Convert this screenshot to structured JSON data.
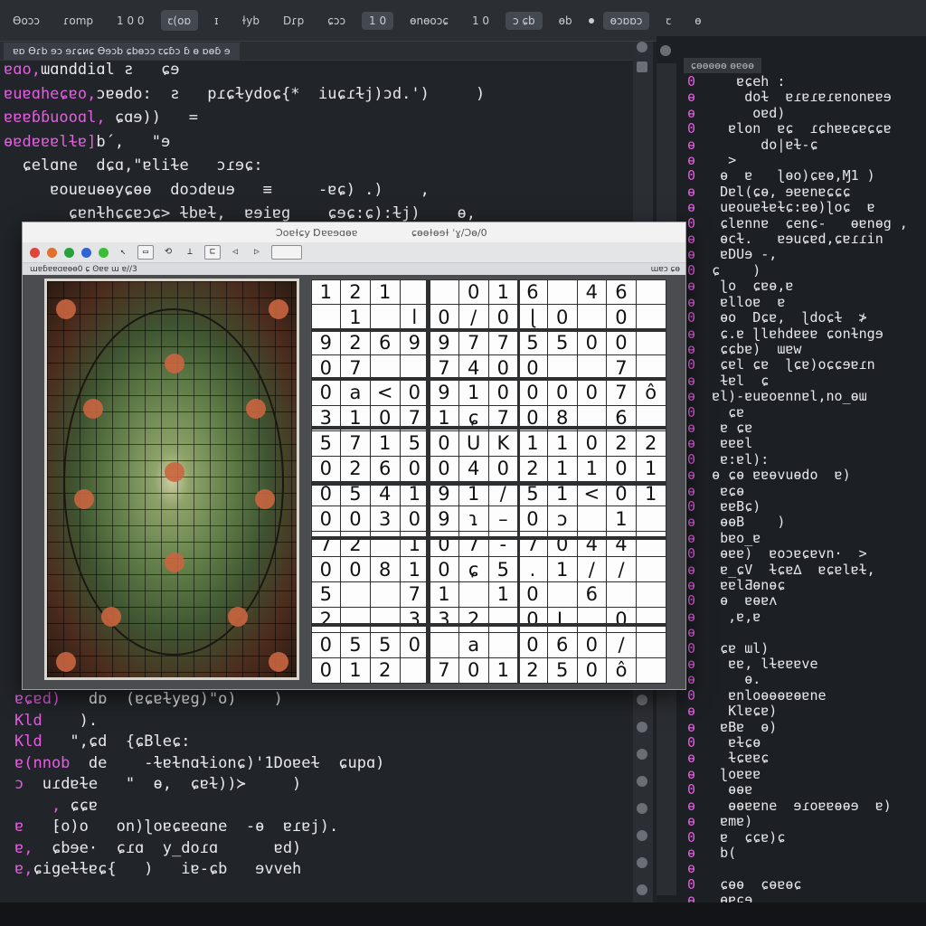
{
  "toolbar": {
    "items": [
      "Ɵoɔɔ",
      "ɾomp",
      "1 0 0",
      "ꞇ(oɒ",
      "ɪ",
      "ɫyb",
      "Dɾp",
      "ɕɔɔ",
      "1 0",
      "ɵnɵoɔɕ",
      "1 0",
      "ɔ ɕb",
      "ɵb",
      "",
      "ɵɔɒɒɔ",
      "ꞇ",
      "ɵ"
    ]
  },
  "left_editor": {
    "tab": "ɐɒ Ɵɾb ɘɔ ɘɾɕᴎɕ Ɵɘɔb ɕbɵɔɔ ꞇɕɓɔ ɓ ɵ ɒɵɓ ɘ",
    "lines": [
      [
        "ɐɑo,",
        "ɯɑnddiɑl",
        " ƨ   ɕɘ"
      ],
      [
        "ɐuɐɑheɕɐo,",
        "ɔɐɵdo:",
        "  ƨ   pɾɕɫydoɕ{*  iuɕɾɫj)ɔd.')     )"
      ],
      [
        "ɐɐɐɓɓuooɑl,",
        "",
        " ɕɑɘ))   ="
      ],
      [
        "ɵɐdɐɐɐlɫɐ]",
        "",
        "b´,   \"ɘ"
      ],
      [
        "",
        "  ɕelɑne",
        "  dɕɑ,\"ɐliɫe   ɔɾɘɕ:"
      ],
      [
        "",
        "     ɐouɐuɵɵyɕɵɵ",
        "  doɔdɐuɘ   ≡     -ɐɕ) .)    ,"
      ],
      [
        "",
        "       ɕɐnɫhɕɕɐɔɕ>",
        " ɫbɐɫ,  ɐɘiɐg    ɕɘɕ:ɕ):ɫj)    ɵ,"
      ]
    ],
    "lower_lines": [
      [
        "ɐɕɐd)",
        "   dɒ  (ɐɕɐɫyɐg)\"o)    )"
      ],
      [
        "Kld",
        "    )."
      ],
      [
        "Kld",
        "   \",ɕd  {ɕBleɕ:"
      ],
      [
        "ɐ(nnob",
        "  de    -ɫɐɫnɑɫionɕ)'1Doɐeɫ  ɕupɑ) "
      ],
      [
        "ɔ ",
        " uɾdɐɫe   \"  ɵ,  ɕɐɫ))≻     )"
      ],
      [
        "    ,",
        " ɕɕɐ"
      ],
      [
        "ɐ",
        "   ⁅o)o   on)ɭoɐɕɐeɑne  -ɵ  ɐɾɐj)."
      ],
      [
        "ɐ,",
        "  ɕbɘe·  ɕɾɑ  y_doɾɑ      ɐd)"
      ],
      [
        "",
        ""
      ],
      [
        "ɐ,",
        "ɕigeɫɫɐɕ{   )   iɐ-ɕb   ɘvveh"
      ]
    ]
  },
  "window": {
    "title_left": "Ɔoɐɫɕy Ɒɐɐɘɑɵɐ",
    "title_right": "ɕɵɵɫɵɘɫ   ˈɣ/Ɔɵ/0",
    "subbar_left": "ɯɐɓɐɐɑɐɵɵ0   ɕ   ʘɐɐ ɯ ɐ//3",
    "subbar_right": "ɯɐɔ ɕɵ",
    "grid_rows": [
      [
        "1",
        "2",
        "1",
        "",
        "",
        "0",
        "1",
        "6",
        "",
        "4",
        "6",
        ""
      ],
      [
        "",
        "1",
        "",
        "l",
        "0",
        "/",
        "0",
        "ɭ",
        "0",
        "",
        "0",
        ""
      ],
      [
        "9",
        "2",
        "6",
        "9",
        "9",
        "7",
        "7",
        "5",
        "5",
        "0",
        "0",
        ""
      ],
      [
        "0",
        "7",
        "",
        "",
        "7",
        "4",
        "0",
        "0",
        "",
        "",
        "7",
        ""
      ],
      [
        "0",
        "a",
        "<",
        "0",
        "9",
        "1",
        "0",
        "0",
        "0",
        "0",
        "7",
        "ô"
      ],
      [
        "3",
        "1",
        "0",
        "7",
        "1",
        "ɕ",
        "7",
        "0",
        "8",
        "",
        "6",
        ""
      ],
      [
        "5",
        "7",
        "1",
        "5",
        "0",
        "U",
        "K",
        "1",
        "1",
        "0",
        "2",
        "2"
      ],
      [
        "0",
        "2",
        "6",
        "0",
        "0",
        "4",
        "0",
        "2",
        "1",
        "1",
        "0",
        "1"
      ],
      [
        "0",
        "5",
        "4",
        "1",
        "9",
        "1",
        "/",
        "5",
        "1",
        "<",
        "0",
        "1"
      ],
      [
        "0",
        "0",
        "3",
        "0",
        "9",
        "ɿ",
        "–",
        "0",
        "ɔ",
        "",
        "1",
        ""
      ],
      [
        "7",
        "2",
        "",
        "1",
        "0",
        "7",
        "-",
        "7",
        "0",
        "4",
        "4",
        ""
      ],
      [
        "0",
        "0",
        "8",
        "1",
        "0",
        "ɕ",
        "5",
        ".",
        "1",
        "/",
        "/",
        ""
      ],
      [
        "5",
        "",
        "",
        "7",
        "1",
        "",
        "1",
        "0",
        "",
        "6",
        "",
        ""
      ],
      [
        "2",
        "",
        "",
        "3",
        "3",
        "2",
        "",
        "0",
        "L",
        "",
        "0",
        ""
      ],
      [
        "0",
        "5",
        "5",
        "0",
        "",
        "a",
        "",
        "0",
        "6",
        "0",
        "/",
        ""
      ],
      [
        "0",
        "1",
        "2",
        "",
        "7",
        "0",
        "1",
        "2",
        "5",
        "0",
        "ô",
        ""
      ]
    ]
  },
  "right_editor": {
    "tab": "ɕɵɵɵɵɵ  ɵɐɵɵ",
    "lines": [
      "    ɐɕeh :",
      "     doɫ  ɐɾɐɾɐɾɐnonɐɐɘ",
      "      oɐd)",
      "   ɐlon  ɐɕ  ɾɕhɐɐɕɐɕɕɐ",
      "       do|ɐɫ-ɕ",
      "   >",
      "  ɵ  ɐ   ɭɵo)ɕɐɵ,Ɱ1 )",
      "  Dɐl(ɕɵ, ɘɐɐnɐɕɕɕ",
      "  uɐouɐɫɐɫɕ:ɐɵ)ɭoɕ  ɐ",
      "  ɕlɐnnɐ  ɕenɕ-   ɵɐnɵg ,",
      "  ɵcɫ.   ɐɘuɕɐd,ɕɐɾɾin",
      "  ɐDUɘ -,",
      " ɕ    )",
      "  ɭo  ɕɐɵ,ɐ",
      "  ɐlloɐ  ɐ",
      "  ɵo  Dɕɐ,  ɭdoɕɫ  ≯",
      "  ɕ.ɐ ɭlɐhdɐɐɐ ɕonɫngɘ",
      "  ɕɕbɐ)  ɯɐw",
      "  ɕɐl ɕɐ  ɭɕɐ)oɕɕɘɐɾn",
      "  ɫɐl  ɕ",
      " ɐl)-ɐuɐoɐnnɐl,no_ɵɯ",
      "   ɕɐ",
      "  ɐ ɕɐ",
      "  ɐɐɐl",
      "  ɐ:ɐl):",
      " ɵ ɕɵ ɐɐɵvuɵdo  ɐ)",
      "  ɐɕɵ",
      "  ɐɐBɕ)",
      "  ɵɵB    )",
      "  bɐo_ɐ",
      "  ɵɐɐ)  ɐoɔɐɕɐvn·  >",
      "  ɐ_ɕV  ɫɕɐ∆  ɐɕɐlɐɫ,",
      "  ɐɐlƋɵnɵɕ",
      "  ɵ  ɐɵɐʌ",
      "   ,ɐ,ɐ",
      "",
      "  ɕɐ ɯl)",
      "   ɐɐ, lɫɐɐɐve",
      "     ɵ.",
      "   ɐnloɵɵɵɐɵɐne",
      "   Klɐɕɐ)",
      "  ɐBɐ  ɵ)",
      "   ɐɫɕɵ",
      "   ɫɕɐɐɕ",
      "  ɭoɐɐɐ",
      "   ɵɵɐ",
      "   ɵɵɐɐne  ɘɾoɐɐɵɵɘ  ɐ)",
      "  ɐmɐ)",
      "  ɐ  ɕɕɐ)ɕ",
      "  b(",
      "",
      "  ɕɵɵ  ɕɵɐɵɕ",
      "  ɵɐɕɘ"
    ]
  }
}
